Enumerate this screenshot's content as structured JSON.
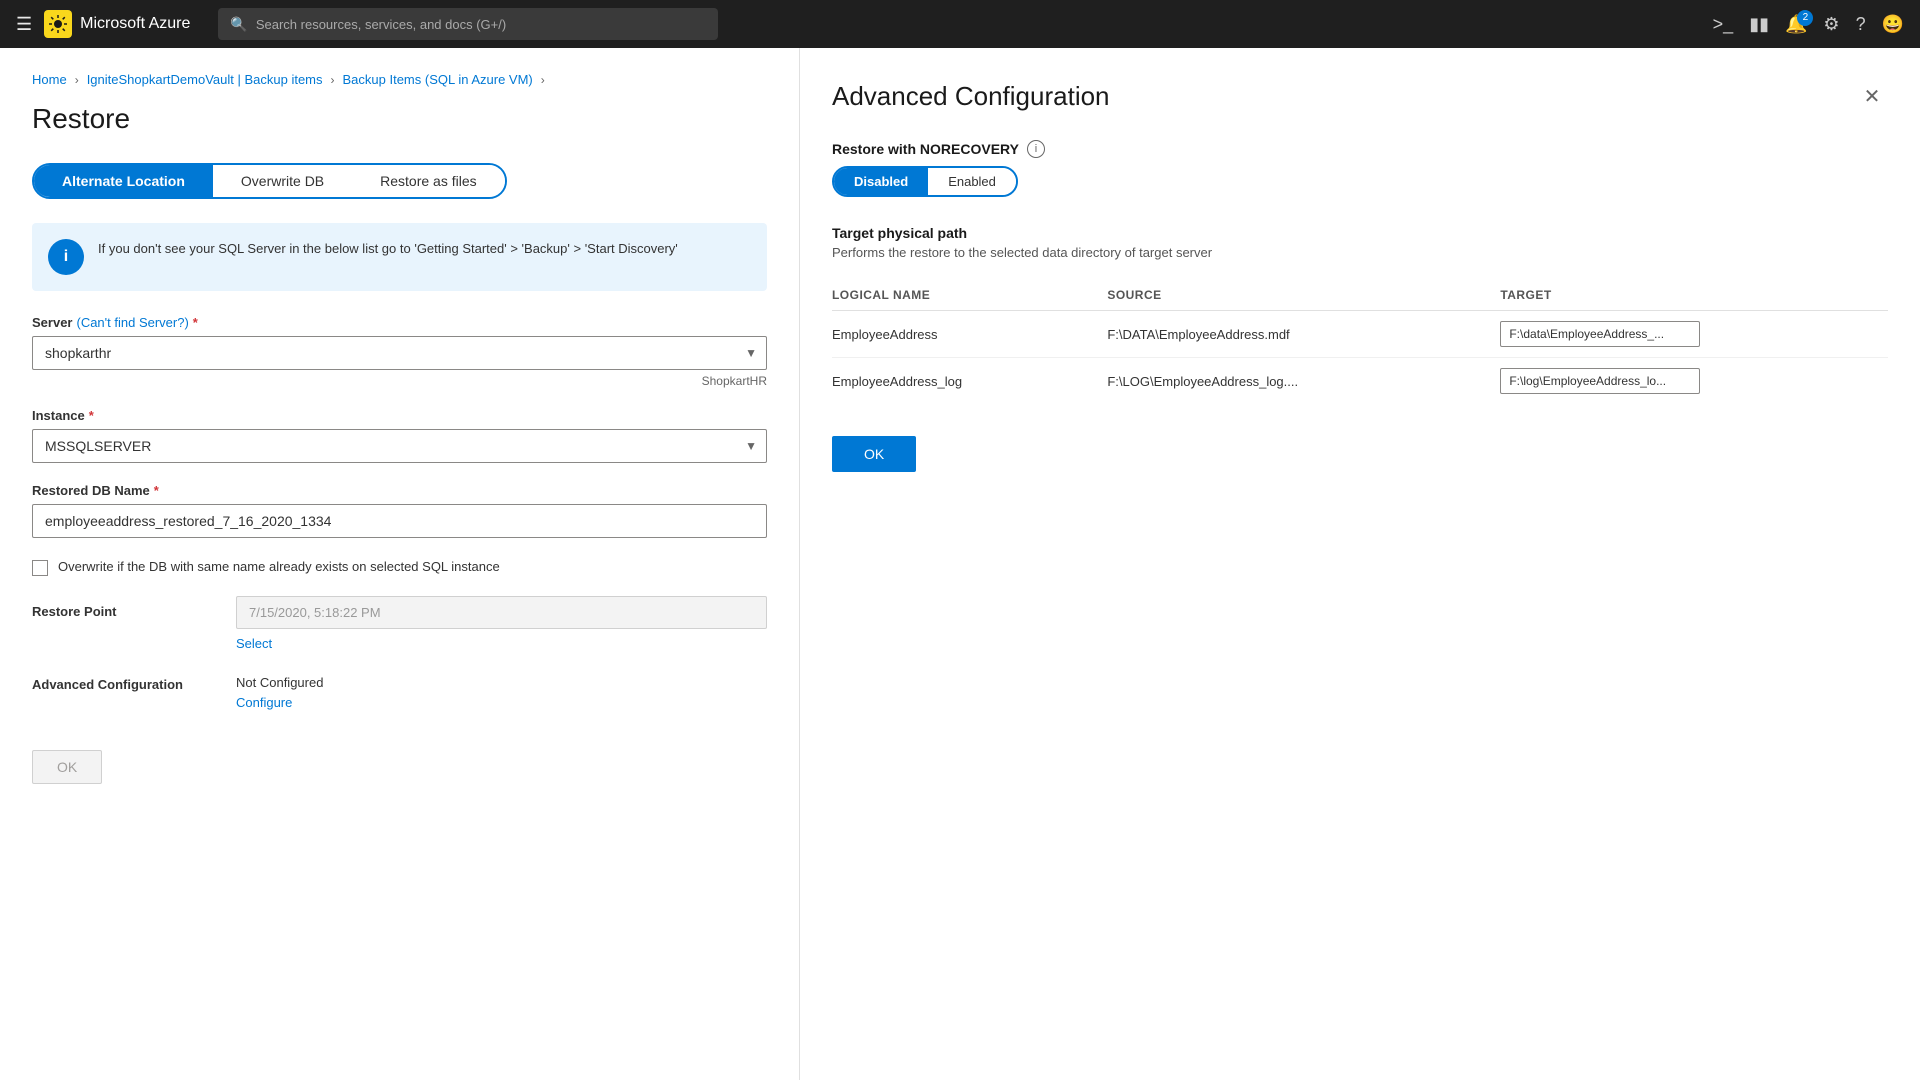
{
  "topnav": {
    "hamburger_label": "☰",
    "logo_text": "Microsoft Azure",
    "search_placeholder": "Search resources, services, and docs (G+/)",
    "notification_count": "2"
  },
  "breadcrumb": {
    "items": [
      {
        "label": "Home",
        "link": true
      },
      {
        "label": "IgniteShopkartDemoVault | Backup items",
        "link": true
      },
      {
        "label": "Backup Items (SQL in Azure VM)",
        "link": true
      }
    ],
    "current": ""
  },
  "restore": {
    "page_title": "Restore",
    "tabs": [
      {
        "label": "Alternate Location",
        "active": true
      },
      {
        "label": "Overwrite DB",
        "active": false
      },
      {
        "label": "Restore as files",
        "active": false
      }
    ],
    "info_message": "If you don't see your SQL Server in the below list go to 'Getting Started' > 'Backup' > 'Start Discovery'",
    "server_label": "Server",
    "cant_find_label": "(Can't find Server?)",
    "server_value": "shopkarthr",
    "server_sub": "ShopkartHR",
    "instance_label": "Instance",
    "instance_value": "MSSQLSERVER",
    "restored_db_label": "Restored DB Name",
    "restored_db_value": "employeeaddress_restored_7_16_2020_1334",
    "overwrite_checkbox_label": "Overwrite if the DB with same name already exists on selected SQL instance",
    "overwrite_checked": false,
    "restore_point_label": "Restore Point",
    "restore_point_date": "7/15/2020, 5:18:22 PM",
    "restore_point_select": "Select",
    "adv_config_label": "Advanced Configuration",
    "adv_config_value": "Not Configured",
    "adv_config_link": "Configure",
    "ok_button": "OK",
    "required_star": "*"
  },
  "advanced_config": {
    "title": "Advanced Configuration",
    "norecovery_label": "Restore with NORECOVERY",
    "norecovery_info": "i",
    "toggle_disabled": "Disabled",
    "toggle_enabled": "Enabled",
    "toggle_active": "Disabled",
    "target_path_title": "Target physical path",
    "target_path_desc": "Performs the restore to the selected data directory of target server",
    "table": {
      "headers": [
        "LOGICAL NAME",
        "SOURCE",
        "TARGET"
      ],
      "rows": [
        {
          "logical_name": "EmployeeAddress",
          "source": "F:\\DATA\\EmployeeAddress.mdf",
          "target_value": "F:\\data\\EmployeeAddress_..."
        },
        {
          "logical_name": "EmployeeAddress_log",
          "source": "F:\\LOG\\EmployeeAddress_log....",
          "target_value": "F:\\log\\EmployeeAddress_lo..."
        }
      ]
    },
    "ok_button": "OK"
  }
}
